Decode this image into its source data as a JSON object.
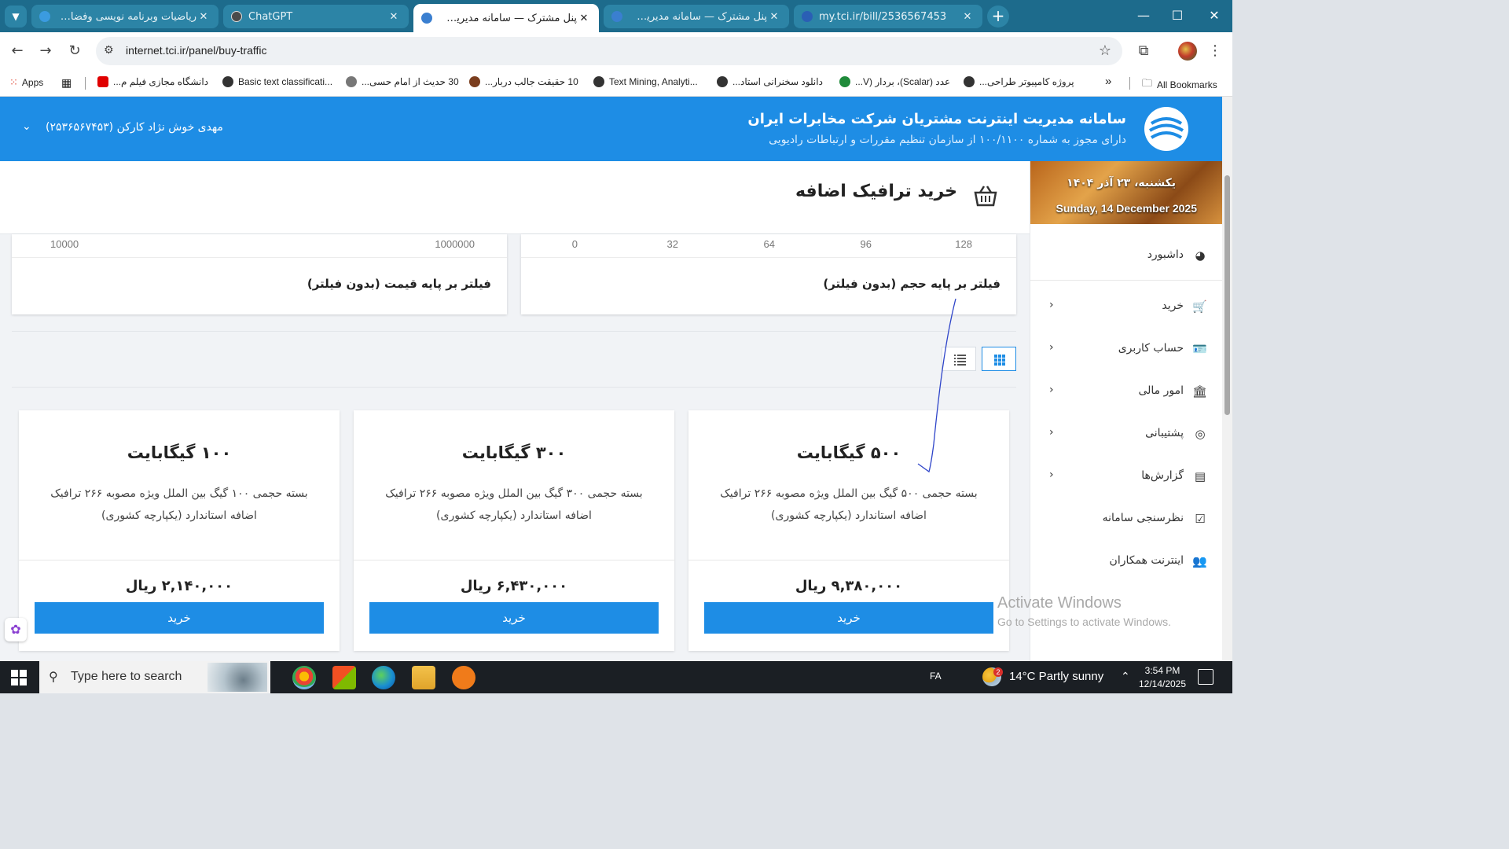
{
  "browser": {
    "tabs": [
      {
        "title": "رياضيات وبرنامه نويسی وفضای ج",
        "rtl": true
      },
      {
        "title": "ChatGPT",
        "rtl": false
      },
      {
        "title": "پنل مشترک — سامانه مدیریت اینت",
        "rtl": true
      },
      {
        "title": "پنل مشترک — سامانه مدیریت اینت",
        "rtl": true
      },
      {
        "title": "my.tci.ir/bill/2536567453",
        "rtl": false
      }
    ],
    "tab_close": "✕",
    "new_tab": "+",
    "url": "internet.tci.ir/panel/buy-traffic",
    "bookmarks": [
      "Apps",
      "دانشگاه مجازی فیلم م...",
      "Basic text classificati...",
      "30 حدیث از امام حسی...",
      "10 حقیقت جالب دربار...",
      "Text Mining, Analyti...",
      "دانلود سخنرانی استاد...",
      "عدد (Scalar)، بردار (V...",
      "پروژه کامپیوتر طراحی..."
    ],
    "all_bookmarks": "All Bookmarks",
    "more": "»"
  },
  "header": {
    "title": "سامانه مدیریت اینترنت مشتریان شرکت مخابرات ایران",
    "subtitle": "دارای مجوز به شماره ۱۰۰/۱۱۰۰ از سازمان تنظیم مقررات و ارتباطات رادیویی",
    "user": "مهدی خوش نژاد کارکن (۲۵۳۶۵۶۷۴۵۳)"
  },
  "date": {
    "fa": "یکشنبه، ۲۳ آذر ۱۴۰۴",
    "en": "Sunday, 14 December 2025"
  },
  "sidebar": {
    "items": [
      {
        "label": "داشبورد",
        "icon": "dashboard-icon",
        "glyph": "◕",
        "chevron": false
      },
      {
        "label": "خرید",
        "icon": "cart-icon",
        "glyph": "🛒",
        "chevron": true
      },
      {
        "label": "حساب کاربری",
        "icon": "id-card-icon",
        "glyph": "🪪",
        "chevron": true
      },
      {
        "label": "امور مالی",
        "icon": "bank-icon",
        "glyph": "🏛",
        "chevron": true
      },
      {
        "label": "پشتیبانی",
        "icon": "support-icon",
        "glyph": "◎",
        "chevron": true
      },
      {
        "label": "گزارش‌ها",
        "icon": "report-icon",
        "glyph": "▤",
        "chevron": true
      },
      {
        "label": "نظرسنجی سامانه",
        "icon": "check-square-icon",
        "glyph": "☑",
        "chevron": false
      },
      {
        "label": "اینترنت همکاران",
        "icon": "users-icon",
        "glyph": "👥",
        "chevron": false
      }
    ]
  },
  "page": {
    "title": "خرید ترافیک اضافه"
  },
  "filters": {
    "volume": {
      "label": "فیلتر بر پایه حجم (بدون فیلتر)",
      "ticks": [
        "128",
        "96",
        "64",
        "32",
        "0"
      ]
    },
    "price": {
      "label": "فیلتر بر پایه قیمت (بدون فیلتر)",
      "ticks": [
        "1000000",
        "10000"
      ]
    }
  },
  "products": [
    {
      "name": "۵۰۰ گیگابایت",
      "desc": "بسته حجمی ۵۰۰ گیگ بین الملل ویژه مصوبه ۲۶۶ ترافیک اضافه استاندارد (یکپارچه کشوری)",
      "price": "۹,۳۸۰,۰۰۰ ریال",
      "buy": "خرید"
    },
    {
      "name": "۳۰۰ گیگابایت",
      "desc": "بسته حجمی ۳۰۰ گیگ بین الملل ویژه مصوبه ۲۶۶ ترافیک اضافه استاندارد (یکپارچه کشوری)",
      "price": "۶,۴۳۰,۰۰۰ ریال",
      "buy": "خرید"
    },
    {
      "name": "۱۰۰ گیگابایت",
      "desc": "بسته حجمی ۱۰۰ گیگ بین الملل ویژه مصوبه ۲۶۶ ترافیک اضافه استاندارد (یکپارچه کشوری)",
      "price": "۲,۱۴۰,۰۰۰ ریال",
      "buy": "خرید"
    }
  ],
  "watermark": {
    "line1": "Activate Windows",
    "line2": "Go to Settings to activate Windows."
  },
  "taskbar": {
    "search_placeholder": "Type here to search",
    "lang": "FA",
    "weather": "14°C  Partly sunny",
    "weather_badge": "2",
    "time": "3:54 PM",
    "date": "12/14/2025"
  },
  "colors": {
    "brand_blue": "#1e8de5",
    "tab_bar": "#1d6b8c",
    "annotation_ink": "#2f45c9"
  }
}
